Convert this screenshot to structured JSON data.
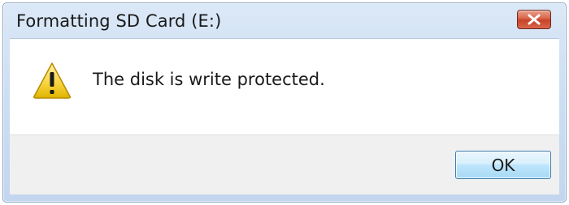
{
  "window": {
    "title": "Formatting SD Card (E:)"
  },
  "dialog": {
    "icon": "warning-icon",
    "message": "The disk is write protected."
  },
  "buttons": {
    "ok_label": "OK",
    "close_icon": "close-icon"
  },
  "colors": {
    "titlebar": "#cddff3",
    "close_button": "#c7432a",
    "content_background": "#ffffff",
    "footer_background": "#f0f0f0",
    "ok_button_border": "#3c7fb1",
    "warning_yellow": "#f6d33c"
  }
}
